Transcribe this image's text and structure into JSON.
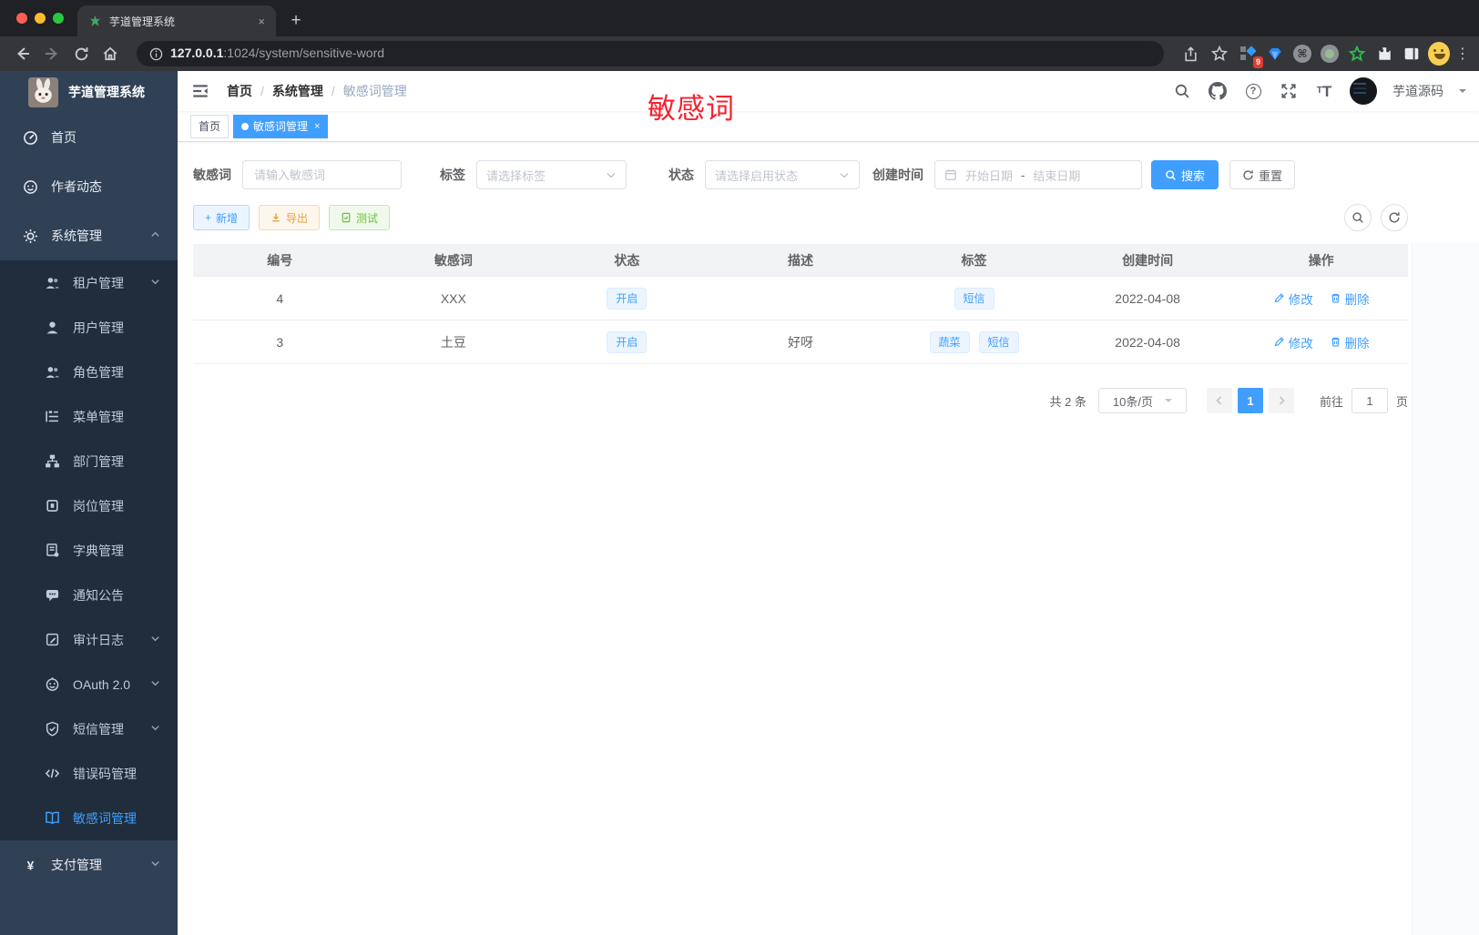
{
  "colors": {
    "accent": "#409eff",
    "annotation_red": "#f5222d",
    "sidebar_bg": "#304156",
    "submenu_bg": "#1f2d3d",
    "success": "#67c23a",
    "warning": "#e6a23c"
  },
  "icons": {
    "close": "×",
    "plus": "+",
    "new_tab": "+",
    "cmd": "⌘",
    "dots": "⋮",
    "question": "?",
    "yen": "¥",
    "code": "</>",
    "font_big": "T",
    "font_small": "T",
    "dash": "-"
  },
  "browser": {
    "tab_title": "芋道管理系统",
    "url_host": "127.0.0.1",
    "url_rest": ":1024/system/sensitive-word",
    "extensions_badge": "9"
  },
  "sidebar": {
    "title": "芋道管理系统",
    "items": [
      {
        "label": "首页",
        "icon": "dashboard-icon",
        "level": 1
      },
      {
        "label": "作者动态",
        "icon": "author-icon",
        "level": 1
      },
      {
        "label": "系统管理",
        "icon": "gear-icon",
        "level": 1,
        "chevron": "up"
      },
      {
        "label": "租户管理",
        "icon": "tenant-icon",
        "level": 2,
        "chevron": "down"
      },
      {
        "label": "用户管理",
        "icon": "user-icon",
        "level": 2
      },
      {
        "label": "角色管理",
        "icon": "role-icon",
        "level": 2
      },
      {
        "label": "菜单管理",
        "icon": "menu-icon",
        "level": 2
      },
      {
        "label": "部门管理",
        "icon": "dept-icon",
        "level": 2
      },
      {
        "label": "岗位管理",
        "icon": "post-icon",
        "level": 2
      },
      {
        "label": "字典管理",
        "icon": "dict-icon",
        "level": 2
      },
      {
        "label": "通知公告",
        "icon": "notice-icon",
        "level": 2
      },
      {
        "label": "审计日志",
        "icon": "audit-icon",
        "level": 2,
        "chevron": "down"
      },
      {
        "label": "OAuth 2.0",
        "icon": "oauth-icon",
        "level": 2,
        "chevron": "down"
      },
      {
        "label": "短信管理",
        "icon": "sms-icon",
        "level": 2,
        "chevron": "down"
      },
      {
        "label": "错误码管理",
        "icon": "errorcode-icon",
        "level": 2
      },
      {
        "label": "敏感词管理",
        "icon": "sensitiveword-icon",
        "level": 2,
        "active": true
      },
      {
        "label": "支付管理",
        "icon": "pay-icon",
        "level": 1,
        "chevron": "down"
      }
    ]
  },
  "navbar": {
    "breadcrumb": [
      "首页",
      "系统管理",
      "敏感词管理"
    ],
    "sep": "/",
    "username": "芋道源码",
    "overlay": "敏感词"
  },
  "tags": {
    "home": "首页",
    "active": "敏感词管理"
  },
  "filters": {
    "keyword_label": "敏感词",
    "keyword_placeholder": "请输入敏感词",
    "tag_label": "标签",
    "tag_placeholder": "请选择标签",
    "status_label": "状态",
    "status_placeholder": "请选择启用状态",
    "date_label": "创建时间",
    "date_start": "开始日期",
    "date_sep": "-",
    "date_end": "结束日期",
    "search": "搜索",
    "reset": "重置"
  },
  "actions": {
    "add": "新增",
    "export": "导出",
    "test": "测试"
  },
  "table": {
    "headers": [
      "编号",
      "敏感词",
      "状态",
      "描述",
      "标签",
      "创建时间",
      "操作"
    ],
    "edit": "修改",
    "del": "删除",
    "rows": [
      {
        "id": "4",
        "word": "XXX",
        "status": "开启",
        "desc": "",
        "tags": [
          "短信"
        ],
        "created": "2022-04-08"
      },
      {
        "id": "3",
        "word": "土豆",
        "status": "开启",
        "desc": "好呀",
        "tags": [
          "蔬菜",
          "短信"
        ],
        "created": "2022-04-08"
      }
    ]
  },
  "pagination": {
    "total": "共 2 条",
    "size": "10条/页",
    "page": "1",
    "goto": "前往",
    "goto_value": "1",
    "unit": "页"
  }
}
